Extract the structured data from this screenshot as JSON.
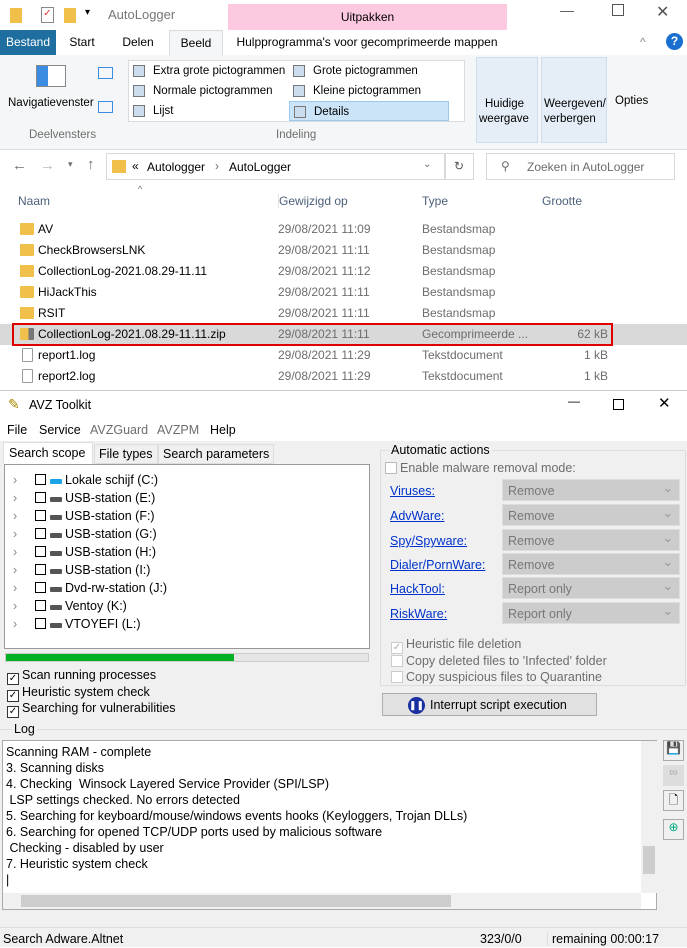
{
  "explorer": {
    "title": "AutoLogger",
    "context_tab": "Uitpakken",
    "context_subtab": "Hulpprogramma's voor gecomprimeerde mappen",
    "tabs": [
      "Bestand",
      "Start",
      "Delen",
      "Beeld"
    ],
    "ribbon": {
      "nav_pane": "Navigatievenster",
      "group_panes": "Deelvensters",
      "layouts": [
        "Extra grote pictogrammen",
        "Grote pictogrammen",
        "Normale pictogrammen",
        "Kleine pictogrammen",
        "Lijst",
        "Details"
      ],
      "group_layout": "Indeling",
      "current_view": [
        "Huidige",
        "weergave"
      ],
      "show_hide": [
        "Weergeven/",
        "verbergen"
      ],
      "options": "Opties"
    },
    "address": {
      "prefix": "«",
      "path": [
        "Autologger",
        "AutoLogger"
      ]
    },
    "search_placeholder": "Zoeken in AutoLogger",
    "columns": [
      "Naam",
      "Gewijzigd op",
      "Type",
      "Grootte"
    ],
    "files": [
      {
        "name": "AV",
        "date": "29/08/2021 11:09",
        "type": "Bestandsmap",
        "size": ""
      },
      {
        "name": "CheckBrowsersLNK",
        "date": "29/08/2021 11:11",
        "type": "Bestandsmap",
        "size": ""
      },
      {
        "name": "CollectionLog-2021.08.29-11.11",
        "date": "29/08/2021 11:12",
        "type": "Bestandsmap",
        "size": ""
      },
      {
        "name": "HiJackThis",
        "date": "29/08/2021 11:11",
        "type": "Bestandsmap",
        "size": ""
      },
      {
        "name": "RSIT",
        "date": "29/08/2021 11:11",
        "type": "Bestandsmap",
        "size": ""
      },
      {
        "name": "CollectionLog-2021.08.29-11.11.zip",
        "date": "29/08/2021 11:11",
        "type": "Gecomprimeerde ...",
        "size": "62 kB"
      },
      {
        "name": "report1.log",
        "date": "29/08/2021 11:29",
        "type": "Tekstdocument",
        "size": "1 kB"
      },
      {
        "name": "report2.log",
        "date": "29/08/2021 11:29",
        "type": "Tekstdocument",
        "size": "1 kB"
      }
    ]
  },
  "avz": {
    "title": "AVZ Toolkit",
    "menu": [
      "File",
      "Service",
      "AVZGuard",
      "AVZPM",
      "Help"
    ],
    "tabs": [
      "Search scope",
      "File types",
      "Search parameters"
    ],
    "drives": [
      "Lokale schijf (C:)",
      "USB-station (E:)",
      "USB-station (F:)",
      "USB-station (G:)",
      "USB-station (H:)",
      "USB-station (I:)",
      "Dvd-rw-station (J:)",
      "Ventoy (K:)",
      "VTOYEFI (L:)"
    ],
    "progress": 0.63,
    "checks": [
      "Scan running processes",
      "Heuristic system check",
      "Searching for vulnerabilities"
    ],
    "auto_actions": {
      "title": "Automatic actions",
      "enable": "Enable malware removal mode:",
      "rows": [
        {
          "label": "Viruses:",
          "value": "Remove"
        },
        {
          "label": "AdvWare:",
          "value": "Remove"
        },
        {
          "label": "Spy/Spyware:",
          "value": "Remove"
        },
        {
          "label": "Dialer/PornWare:",
          "value": "Remove"
        },
        {
          "label": "HackTool:",
          "value": "Report only"
        },
        {
          "label": "RiskWare:",
          "value": "Report only"
        }
      ],
      "opts": [
        "Heuristic file deletion",
        "Copy deleted files to 'Infected' folder",
        "Copy suspicious files to Quarantine"
      ]
    },
    "interrupt": "Interrupt script execution",
    "log_title": "Log",
    "log": [
      "Scanning RAM - complete",
      "3. Scanning disks",
      "4. Checking  Winsock Layered Service Provider (SPI/LSP)",
      " LSP settings checked. No errors detected",
      "5. Searching for keyboard/mouse/windows events hooks (Keyloggers, Trojan DLLs)",
      "6. Searching for opened TCP/UDP ports used by malicious software",
      " Checking - disabled by user",
      "7. Heuristic system check"
    ],
    "status": {
      "text": "Search Adware.Altnet",
      "count": "323/0/0",
      "remaining": "remaining 00:00:17"
    }
  }
}
